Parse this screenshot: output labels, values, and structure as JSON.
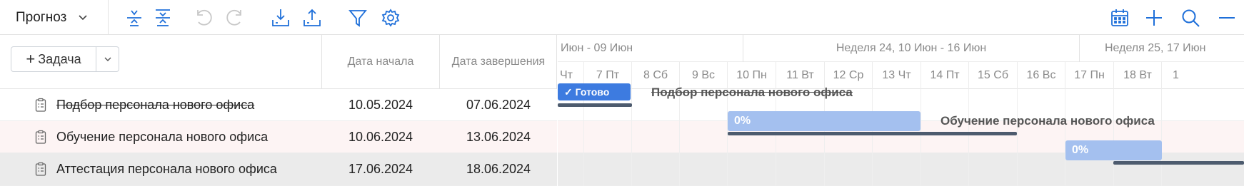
{
  "toolbar": {
    "view_select": "Прогноз",
    "icons_left": [
      "collapse-all-icon",
      "expand-all-icon",
      "undo-icon",
      "redo-icon",
      "import-icon",
      "export-icon",
      "filter-icon",
      "settings-icon"
    ],
    "icons_right": [
      "calendar-icon",
      "add-icon",
      "search-icon",
      "zoom-out-icon"
    ]
  },
  "grid": {
    "add_task_label": "Задача",
    "columns": {
      "start": "Дата начала",
      "end": "Дата завершения"
    },
    "rows": [
      {
        "name": "Подбор персонала нового офиса",
        "start": "10.05.2024",
        "end": "07.06.2024",
        "completed": true
      },
      {
        "name": "Обучение персонала нового офиса",
        "start": "10.06.2024",
        "end": "13.06.2024",
        "completed": false
      },
      {
        "name": "Аттестация персонала нового офиса",
        "start": "17.06.2024",
        "end": "18.06.2024",
        "completed": false
      }
    ]
  },
  "gantt": {
    "weeks": [
      "Июн - 09 Июн",
      "Неделя 24, 10 Июн - 16 Июн",
      "Неделя 25, 17 Июн"
    ],
    "days": [
      "Чт",
      "7 Пт",
      "8 Сб",
      "9 Вс",
      "10 Пн",
      "11 Вт",
      "12 Ср",
      "13 Чт",
      "14 Пт",
      "15 Сб",
      "16 Вс",
      "17 Пн",
      "18 Вт",
      "1"
    ],
    "bars": [
      {
        "text": "Готово",
        "label": "Подбор персонала нового офиса",
        "status": "done"
      },
      {
        "text": "0%",
        "label": "Обучение персонала нового офиса",
        "status": "in-progress"
      },
      {
        "text": "0%",
        "label": "",
        "status": "in-progress"
      }
    ]
  },
  "colors": {
    "accent": "#1e6fd9",
    "bar_done": "#3d7be0",
    "bar_progress": "#a4c0ef",
    "row_selected": "#fdf4f4",
    "row_hover": "#ebebeb"
  }
}
